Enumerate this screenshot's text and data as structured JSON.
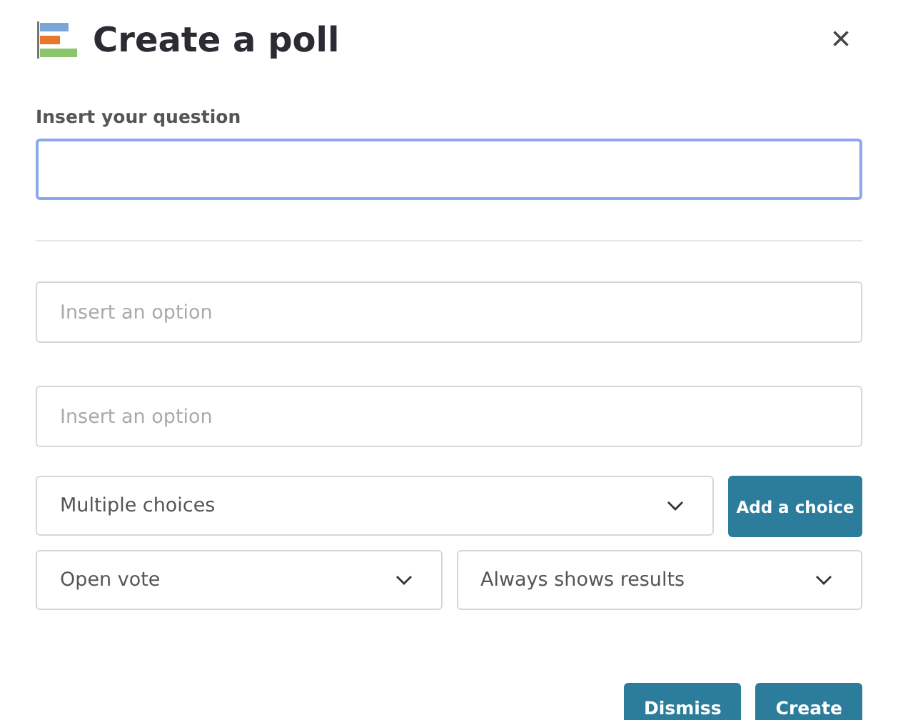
{
  "dialog": {
    "title": "Create a poll",
    "close": "×"
  },
  "question": {
    "label": "Insert your question",
    "focused": true
  },
  "options": [
    {
      "placeholder": "Insert an option"
    },
    {
      "placeholder": "Insert an option"
    }
  ],
  "choice_type": {
    "value": "Multiple choices"
  },
  "add_button": "Add a choice",
  "vote_type": {
    "value": "Open vote"
  },
  "results_mode": {
    "value": "Always shows results"
  },
  "buttons": [
    {
      "label": "Dismiss"
    },
    {
      "label": "Create"
    }
  ]
}
